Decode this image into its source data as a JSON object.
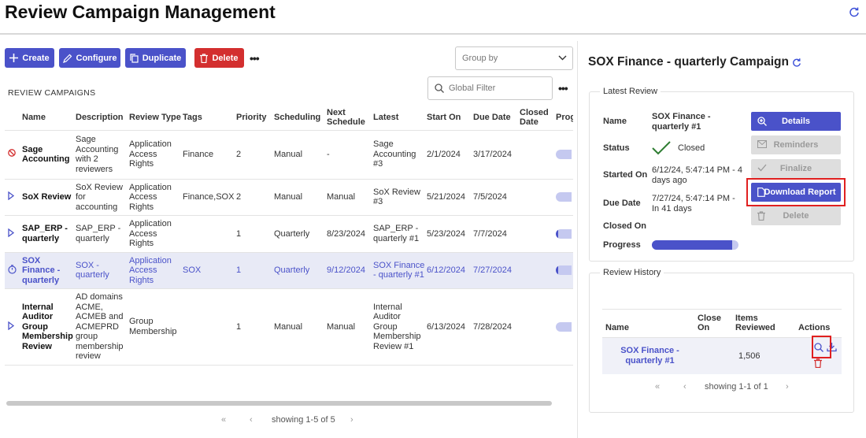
{
  "page": {
    "title": "Review Campaign Management"
  },
  "toolbar": {
    "create_label": "Create",
    "configure_label": "Configure",
    "duplicate_label": "Duplicate",
    "delete_label": "Delete",
    "more_label": "•••"
  },
  "group_by": {
    "placeholder": "Group by"
  },
  "campaigns": {
    "section_label": "REVIEW CAMPAIGNS",
    "filter_placeholder": "Global Filter",
    "columns": [
      "Name",
      "Description",
      "Review Type",
      "Tags",
      "Priority",
      "Scheduling",
      "Next Schedule",
      "Latest",
      "Start On",
      "Due Date",
      "Closed Date",
      "Prog"
    ],
    "rows": [
      {
        "status_icon": "blocked-icon",
        "name": "Sage Accounting",
        "description": "Sage Accounting with 2 reviewers",
        "review_type": "Application Access Rights",
        "tags": "Finance",
        "priority": "2",
        "scheduling": "Manual",
        "next_schedule": "-",
        "latest": "Sage Accounting #3",
        "start_on": "2/1/2024",
        "due_date": "3/17/2024",
        "closed_date": "",
        "progress": 0.0
      },
      {
        "status_icon": "play-icon",
        "name": "SoX Review",
        "description": "SoX Review for accounting",
        "review_type": "Application Access Rights",
        "tags": "Finance,SOX",
        "priority": "2",
        "scheduling": "Manual",
        "next_schedule": "Manual",
        "latest": "SoX Review #3",
        "start_on": "5/21/2024",
        "due_date": "7/5/2024",
        "closed_date": "",
        "progress": 0.0
      },
      {
        "status_icon": "play-icon",
        "name": "SAP_ERP - quarterly",
        "description": "SAP_ERP - quarterly",
        "review_type": "Application Access Rights",
        "tags": "",
        "priority": "1",
        "scheduling": "Quarterly",
        "next_schedule": "8/23/2024",
        "latest": "SAP_ERP - quarterly #1",
        "start_on": "5/23/2024",
        "due_date": "7/7/2024",
        "closed_date": "",
        "progress": 0.1
      },
      {
        "status_icon": "timer-icon",
        "name": "SOX Finance - quarterly",
        "description": "SOX - quarterly",
        "review_type": "Application Access Rights",
        "tags": "SOX",
        "priority": "1",
        "scheduling": "Quarterly",
        "next_schedule": "9/12/2024",
        "latest": "SOX Finance - quarterly #1",
        "start_on": "6/12/2024",
        "due_date": "7/27/2024",
        "closed_date": "",
        "progress": 0.1
      },
      {
        "status_icon": "play-icon",
        "name": "Internal Auditor Group Membership Review",
        "description": "AD domains ACME, ACMEB and ACMEPRD group membership review",
        "review_type": "Group Membership",
        "tags": "",
        "priority": "1",
        "scheduling": "Manual",
        "next_schedule": "Manual",
        "latest": "Internal Auditor Group Membership Review #1",
        "start_on": "6/13/2024",
        "due_date": "7/28/2024",
        "closed_date": "",
        "progress": 0.0
      }
    ],
    "pager_text": "showing 1-5 of 5"
  },
  "detail": {
    "title": "SOX Finance - quarterly Campaign",
    "latest_review": {
      "card_title": "Latest Review",
      "name_label": "Name",
      "name_value": "SOX Finance - quarterly #1",
      "status_label": "Status",
      "status_value": "Closed",
      "started_label": "Started On",
      "started_value": "6/12/24, 5:47:14 PM - 4 days ago",
      "due_label": "Due Date",
      "due_value": "7/27/24, 5:47:14 PM - In 41 days",
      "closed_label": "Closed On",
      "closed_value": "",
      "progress_label": "Progress",
      "progress": 0.93,
      "buttons": {
        "details": "Details",
        "reminders": "Reminders",
        "finalize": "Finalize",
        "download_report": "Download Report",
        "delete": "Delete"
      }
    },
    "history": {
      "card_title": "Review History",
      "columns": [
        "Name",
        "Close On",
        "Items Reviewed",
        "Actions"
      ],
      "rows": [
        {
          "name": "SOX Finance - quarterly #1",
          "close_on": "",
          "items_reviewed": "1,506"
        }
      ],
      "pager_text": "showing 1-1 of 1"
    }
  },
  "colors": {
    "accent": "#4a52c9",
    "danger": "#d32f2f",
    "highlight": "#e02020",
    "success": "#2e7d32"
  }
}
